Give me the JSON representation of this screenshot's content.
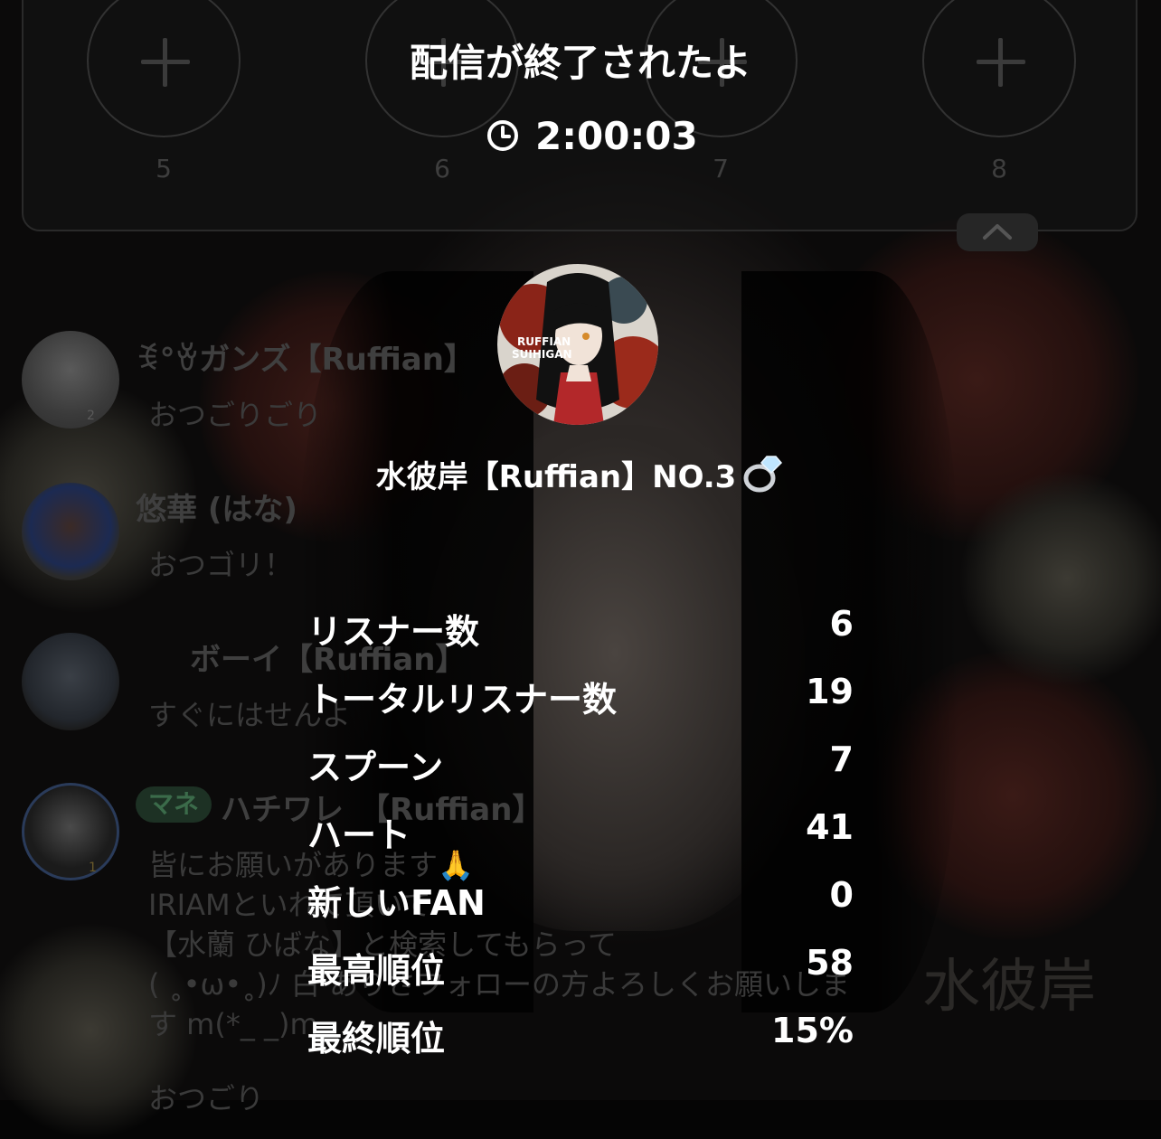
{
  "overlay": {
    "title": "配信が終了されたよ",
    "duration": "2:00:03",
    "host_name": "水彼岸【Ruffian】NO.3",
    "host_avatar_text_1": "RUFFIAN",
    "host_avatar_text_2": "SUIHIGAN"
  },
  "stats": [
    {
      "label": "リスナー数",
      "value": "6"
    },
    {
      "label": "トータルリスナー数",
      "value": "19"
    },
    {
      "label": "スプーン",
      "value": "7"
    },
    {
      "label": "ハート",
      "value": "41"
    },
    {
      "label": "新しいFAN",
      "value": "0"
    },
    {
      "label": "最高順位",
      "value": "58"
    },
    {
      "label": "最終順位",
      "value": "15%"
    }
  ],
  "slots": [
    "5",
    "6",
    "7",
    "8"
  ],
  "chat": [
    {
      "name": "ꉂ°ꈊガンズ【Ruffian】",
      "message": "おつごりごり",
      "badge": "2"
    },
    {
      "name": "悠華 (はな)",
      "message": "おつゴリ！"
    },
    {
      "name": "ボーイ【Ruffian】",
      "message": "すぐにはせんよ"
    },
    {
      "tag": "マネ",
      "name": "ハチワレ　【Ruffian】",
      "badge": "1",
      "message_lines": [
        "皆にお願いがあります🙏",
        "IRIAMといれて頂いて",
        "【水蘭 ひばな】と検索してもらって",
        "( ˳•ω•˳)ﾉ 白 ありさフォローの方よろしくお願いしま",
        "す m(*_ _)m"
      ]
    },
    {
      "message": "おつごり"
    }
  ],
  "background_signature": "水彼岸"
}
